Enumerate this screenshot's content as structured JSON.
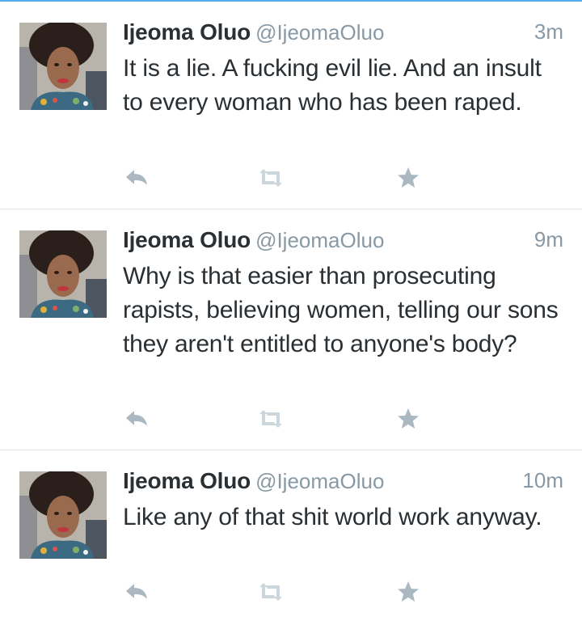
{
  "colors": {
    "accent": "#55acee",
    "text": "#292f33",
    "muted": "#8899a6",
    "icon": "#aab8c2",
    "icon_light": "#ccd6dd",
    "divider": "#e1e8ed"
  },
  "tweets": [
    {
      "name": "Ijeoma Oluo",
      "handle": "@IjeomaOluo",
      "time": "3m",
      "text": "It is a lie. A fucking evil lie. And an insult to every woman who has been raped."
    },
    {
      "name": "Ijeoma Oluo",
      "handle": "@IjeomaOluo",
      "time": "9m",
      "text": "Why is that easier than prosecuting rapists, believing women, telling our sons they aren't entitled to anyone's body?"
    },
    {
      "name": "Ijeoma Oluo",
      "handle": "@IjeomaOluo",
      "time": "10m",
      "text": "Like any of that shit world work anyway."
    }
  ],
  "icons": {
    "reply": "reply-icon",
    "retweet": "retweet-icon",
    "favorite": "star-icon"
  }
}
